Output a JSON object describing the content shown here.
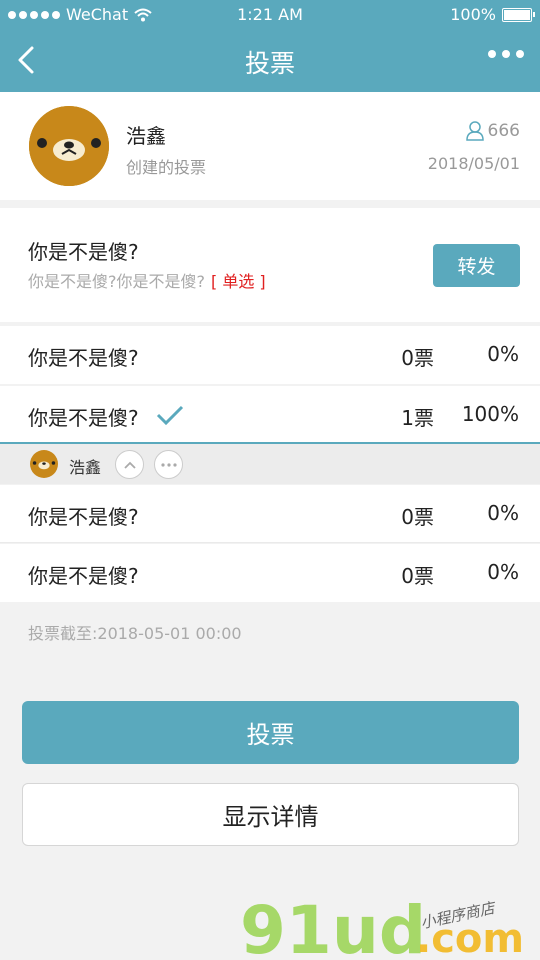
{
  "status_bar": {
    "carrier": "WeChat",
    "time": "1:21 AM",
    "battery": "100%"
  },
  "nav": {
    "title": "投票"
  },
  "author": {
    "name": "浩鑫",
    "subtitle": "创建的投票",
    "participants": "666",
    "date": "2018/05/01"
  },
  "question": {
    "title": "你是不是傻?",
    "description": "你是不是傻?你是不是傻?",
    "type": "[ 单选 ]",
    "share_label": "转发"
  },
  "options": [
    {
      "label": "你是不是傻?",
      "votes": "0票",
      "percent": "0%"
    },
    {
      "label": "你是不是傻?",
      "votes": "1票",
      "percent": "100%"
    },
    {
      "label": "你是不是傻?",
      "votes": "0票",
      "percent": "0%"
    },
    {
      "label": "你是不是傻?",
      "votes": "0票",
      "percent": "0%"
    }
  ],
  "voters": {
    "name": "浩鑫"
  },
  "deadline": "投票截至:2018-05-01 00:00",
  "actions": {
    "vote_label": "投票",
    "detail_label": "显示详情"
  },
  "watermark": {
    "brand": "91ud",
    "domain": ".com",
    "tagline": "小程序商店"
  },
  "colors": {
    "accent": "#5aa9bd",
    "danger": "#e02020"
  }
}
